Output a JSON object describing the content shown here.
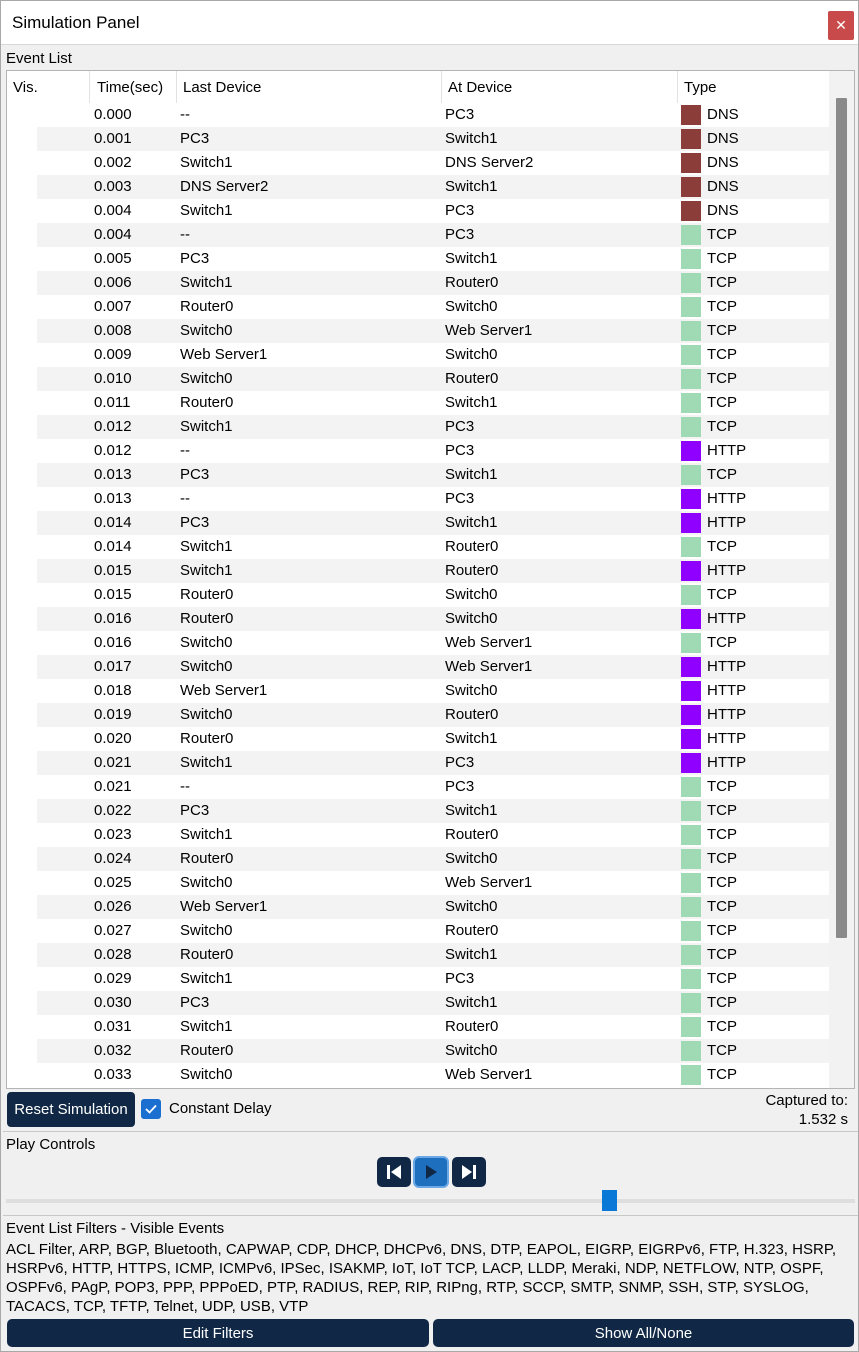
{
  "window": {
    "title": "Simulation Panel",
    "close_glyph": "✕"
  },
  "event_list": {
    "label": "Event List",
    "columns": [
      "Vis.",
      "Time(sec)",
      "Last Device",
      "At Device",
      "Type"
    ],
    "type_colors": {
      "DNS": "#8b3d3a",
      "TCP": "#9fdab5",
      "HTTP": "#8f00ff"
    },
    "rows": [
      {
        "time": "0.000",
        "last": "--",
        "at": "PC3",
        "type": "DNS"
      },
      {
        "time": "0.001",
        "last": "PC3",
        "at": "Switch1",
        "type": "DNS"
      },
      {
        "time": "0.002",
        "last": "Switch1",
        "at": "DNS Server2",
        "type": "DNS"
      },
      {
        "time": "0.003",
        "last": "DNS Server2",
        "at": "Switch1",
        "type": "DNS"
      },
      {
        "time": "0.004",
        "last": "Switch1",
        "at": "PC3",
        "type": "DNS"
      },
      {
        "time": "0.004",
        "last": "--",
        "at": "PC3",
        "type": "TCP"
      },
      {
        "time": "0.005",
        "last": "PC3",
        "at": "Switch1",
        "type": "TCP"
      },
      {
        "time": "0.006",
        "last": "Switch1",
        "at": "Router0",
        "type": "TCP"
      },
      {
        "time": "0.007",
        "last": "Router0",
        "at": "Switch0",
        "type": "TCP"
      },
      {
        "time": "0.008",
        "last": "Switch0",
        "at": "Web Server1",
        "type": "TCP"
      },
      {
        "time": "0.009",
        "last": "Web Server1",
        "at": "Switch0",
        "type": "TCP"
      },
      {
        "time": "0.010",
        "last": "Switch0",
        "at": "Router0",
        "type": "TCP"
      },
      {
        "time": "0.011",
        "last": "Router0",
        "at": "Switch1",
        "type": "TCP"
      },
      {
        "time": "0.012",
        "last": "Switch1",
        "at": "PC3",
        "type": "TCP"
      },
      {
        "time": "0.012",
        "last": "--",
        "at": "PC3",
        "type": "HTTP"
      },
      {
        "time": "0.013",
        "last": "PC3",
        "at": "Switch1",
        "type": "TCP"
      },
      {
        "time": "0.013",
        "last": "--",
        "at": "PC3",
        "type": "HTTP"
      },
      {
        "time": "0.014",
        "last": "PC3",
        "at": "Switch1",
        "type": "HTTP"
      },
      {
        "time": "0.014",
        "last": "Switch1",
        "at": "Router0",
        "type": "TCP"
      },
      {
        "time": "0.015",
        "last": "Switch1",
        "at": "Router0",
        "type": "HTTP"
      },
      {
        "time": "0.015",
        "last": "Router0",
        "at": "Switch0",
        "type": "TCP"
      },
      {
        "time": "0.016",
        "last": "Router0",
        "at": "Switch0",
        "type": "HTTP"
      },
      {
        "time": "0.016",
        "last": "Switch0",
        "at": "Web Server1",
        "type": "TCP"
      },
      {
        "time": "0.017",
        "last": "Switch0",
        "at": "Web Server1",
        "type": "HTTP"
      },
      {
        "time": "0.018",
        "last": "Web Server1",
        "at": "Switch0",
        "type": "HTTP"
      },
      {
        "time": "0.019",
        "last": "Switch0",
        "at": "Router0",
        "type": "HTTP"
      },
      {
        "time": "0.020",
        "last": "Router0",
        "at": "Switch1",
        "type": "HTTP"
      },
      {
        "time": "0.021",
        "last": "Switch1",
        "at": "PC3",
        "type": "HTTP"
      },
      {
        "time": "0.021",
        "last": "--",
        "at": "PC3",
        "type": "TCP"
      },
      {
        "time": "0.022",
        "last": "PC3",
        "at": "Switch1",
        "type": "TCP"
      },
      {
        "time": "0.023",
        "last": "Switch1",
        "at": "Router0",
        "type": "TCP"
      },
      {
        "time": "0.024",
        "last": "Router0",
        "at": "Switch0",
        "type": "TCP"
      },
      {
        "time": "0.025",
        "last": "Switch0",
        "at": "Web Server1",
        "type": "TCP"
      },
      {
        "time": "0.026",
        "last": "Web Server1",
        "at": "Switch0",
        "type": "TCP"
      },
      {
        "time": "0.027",
        "last": "Switch0",
        "at": "Router0",
        "type": "TCP"
      },
      {
        "time": "0.028",
        "last": "Router0",
        "at": "Switch1",
        "type": "TCP"
      },
      {
        "time": "0.029",
        "last": "Switch1",
        "at": "PC3",
        "type": "TCP"
      },
      {
        "time": "0.030",
        "last": "PC3",
        "at": "Switch1",
        "type": "TCP"
      },
      {
        "time": "0.031",
        "last": "Switch1",
        "at": "Router0",
        "type": "TCP"
      },
      {
        "time": "0.032",
        "last": "Router0",
        "at": "Switch0",
        "type": "TCP"
      },
      {
        "time": "0.033",
        "last": "Switch0",
        "at": "Web Server1",
        "type": "TCP"
      }
    ]
  },
  "controls": {
    "reset_label": "Reset Simulation",
    "constant_delay_label": "Constant Delay",
    "constant_delay_checked": true,
    "captured_label": "Captured to:",
    "captured_value": "1.532 s"
  },
  "play_controls": {
    "label": "Play Controls",
    "buttons": [
      "skip-back-icon",
      "play-icon",
      "skip-forward-icon"
    ],
    "slider_position": 0.715
  },
  "filters": {
    "label": "Event List Filters - Visible Events",
    "text": "ACL Filter, ARP, BGP, Bluetooth, CAPWAP, CDP, DHCP, DHCPv6, DNS, DTP, EAPOL, EIGRP, EIGRPv6, FTP, H.323, HSRP, HSRPv6, HTTP, HTTPS, ICMP, ICMPv6, IPSec, ISAKMP, IoT, IoT TCP, LACP, LLDP, Meraki, NDP, NETFLOW, NTP, OSPF, OSPFv6, PAgP, POP3, PPP, PPPoED, PTP, RADIUS, REP, RIP, RIPng, RTP, SCCP, SMTP, SNMP, SSH, STP, SYSLOG, TACACS, TCP, TFTP, Telnet, UDP, USB, VTP",
    "edit_label": "Edit Filters",
    "show_label": "Show All/None"
  }
}
